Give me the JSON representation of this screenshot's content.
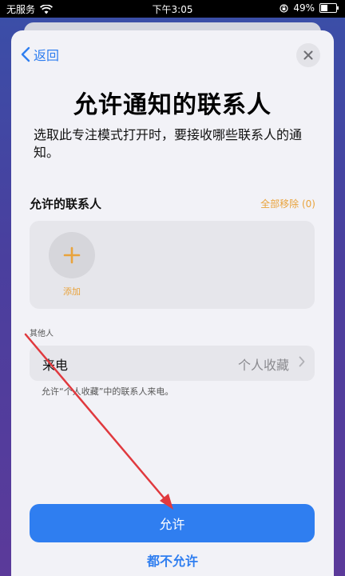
{
  "status_bar": {
    "carrier": "无服务",
    "time": "下午3:05",
    "battery": "49%",
    "battery_level": 0.49
  },
  "nav": {
    "back_label": "返回"
  },
  "header": {
    "title": "允许通知的联系人",
    "subtitle": "选取此专注模式打开时，要接收哪些联系人的通知。"
  },
  "allowed_contacts": {
    "label": "允许的联系人",
    "remove_all": "全部移除 (0)",
    "add_label": "添加"
  },
  "others": {
    "label": "其他人",
    "calls_label": "来电",
    "calls_value": "个人收藏",
    "calls_note": "允许“个人收藏”中的联系人来电。"
  },
  "buttons": {
    "allow": "允许",
    "deny": "都不允许"
  },
  "colors": {
    "accent": "#2f7ef0",
    "orange": "#e9a33c",
    "annotation_arrow": "#e0393e"
  }
}
